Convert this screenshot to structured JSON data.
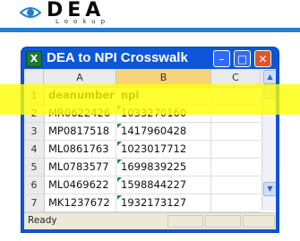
{
  "logo": {
    "title": "DEA",
    "subtitle": "Lookup"
  },
  "window": {
    "title": "DEA to NPI Crosswalk",
    "buttons": {
      "minimize": "–",
      "maximize": "□",
      "close": "✕"
    }
  },
  "grid": {
    "columns": [
      "A",
      "B",
      "C"
    ],
    "rows": [
      {
        "num": "1",
        "a": "deanumber",
        "b": "npi"
      },
      {
        "num": "2",
        "a": "MR0622426",
        "b": "1033270160"
      },
      {
        "num": "3",
        "a": "MP0817518",
        "b": "1417960428"
      },
      {
        "num": "4",
        "a": "ML0861763",
        "b": "1023017712"
      },
      {
        "num": "5",
        "a": "ML0783577",
        "b": "1699839225"
      },
      {
        "num": "6",
        "a": "ML0469622",
        "b": "1598844227"
      },
      {
        "num": "7",
        "a": "MK1237672",
        "b": "1932173127"
      }
    ]
  },
  "status": {
    "text": "Ready"
  },
  "colors": {
    "titlebar": "#0e56d8",
    "highlight": "#ffff00",
    "stripe": "#1f7fd0"
  }
}
